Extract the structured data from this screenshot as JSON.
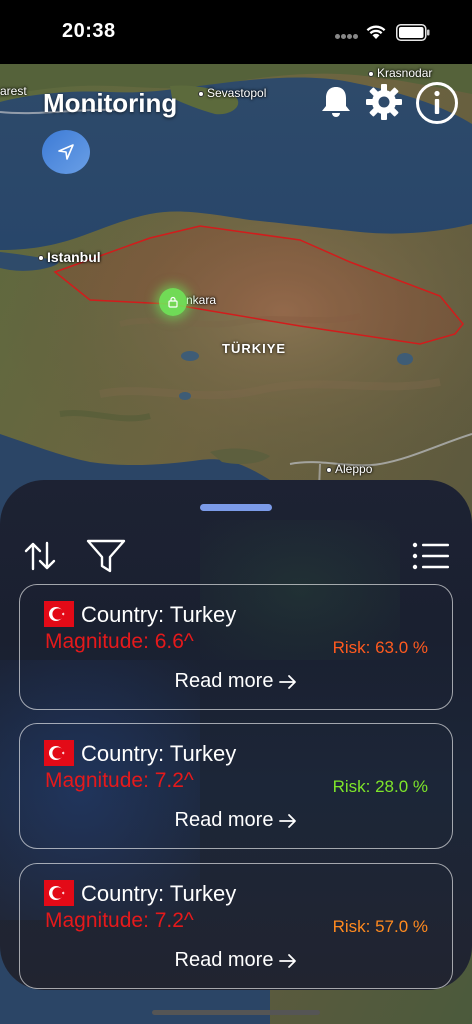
{
  "status_bar": {
    "time": "20:38"
  },
  "map": {
    "cities": [
      {
        "name": "arest"
      },
      {
        "name": "Sevastopol"
      },
      {
        "name": "Krasnodar"
      },
      {
        "name": "Istanbul"
      },
      {
        "name": "nkara"
      },
      {
        "name": "Aleppo"
      }
    ],
    "country": "TÜRKIYE"
  },
  "header": {
    "title": "Monitoring",
    "icons": [
      "location-arrow-icon",
      "bell-icon",
      "gear-icon",
      "info-icon"
    ]
  },
  "colors": {
    "accent": "#5b8fe0",
    "magnitude": "#e5191b",
    "risk_high": "#ff5a1f",
    "risk_low": "#7ee52a",
    "risk_mid": "#ff8a1f",
    "polygon": "#d21c1c",
    "marker": "#6ef05a"
  },
  "toolbar": {
    "icons": [
      "sort-icon",
      "filter-icon",
      "list-icon"
    ]
  },
  "cards": [
    {
      "country": "Country: Turkey",
      "magnitude": "Magnitude: 6.6^",
      "risk": "Risk: 63.0 %",
      "risk_color": "#ff5a1f",
      "read_more": "Read more"
    },
    {
      "country": "Country: Turkey",
      "magnitude": "Magnitude: 7.2^",
      "risk": "Risk: 28.0 %",
      "risk_color": "#7ee52a",
      "read_more": "Read more"
    },
    {
      "country": "Country: Turkey",
      "magnitude": "Magnitude: 7.2^",
      "risk": "Risk: 57.0 %",
      "risk_color": "#ff8a1f",
      "read_more": "Read more"
    }
  ]
}
